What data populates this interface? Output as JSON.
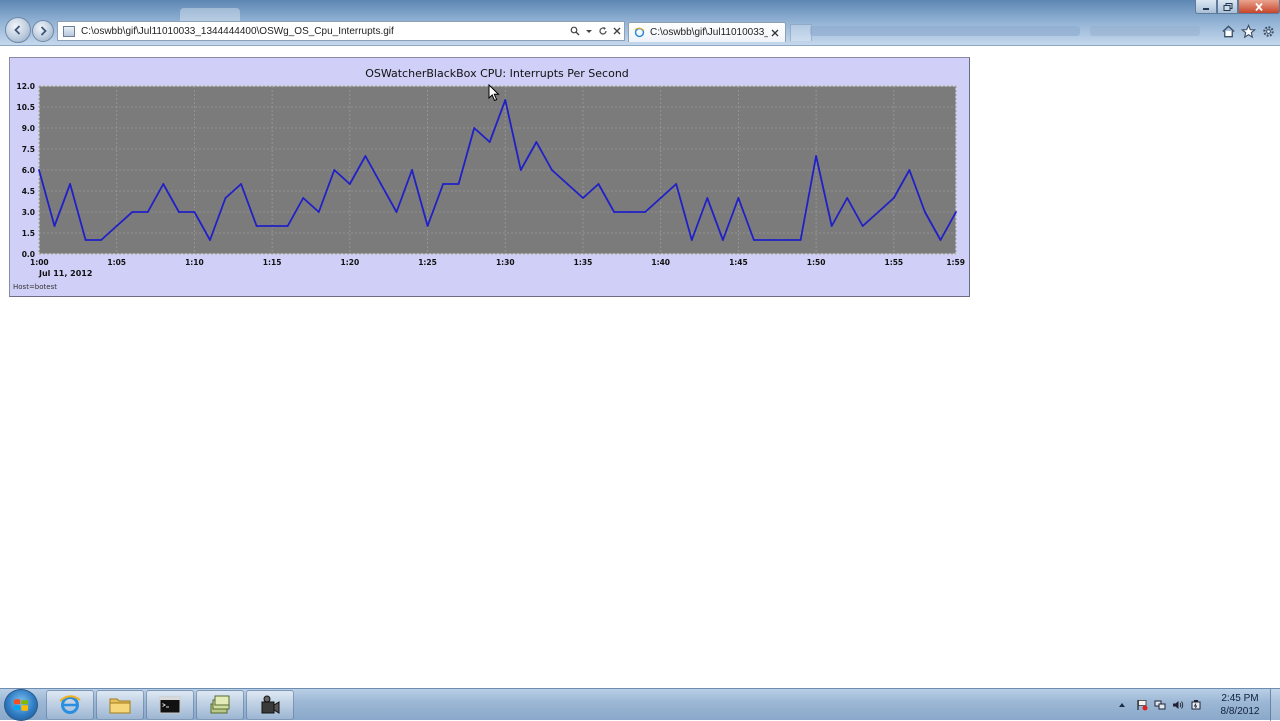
{
  "browser": {
    "address": "C:\\oswbb\\gif\\Jul11010033_1344444400\\OSWg_OS_Cpu_Interrupts.gif",
    "active_tab_title": "C:\\oswbb\\gif\\Jul11010033_...",
    "colors": {
      "chrome": "#9db8d6",
      "close": "#c7452b"
    }
  },
  "chart_data": {
    "type": "line",
    "title": "OSWatcherBlackBox CPU: Interrupts Per Second",
    "date_label": "Jul 11, 2012",
    "footnote": "Host=botest",
    "xlabel": "",
    "ylabel": "",
    "xlim": [
      0,
      59
    ],
    "ylim": [
      0,
      12
    ],
    "grid": true,
    "y_ticks": [
      "0.0",
      "1.5",
      "3.0",
      "4.5",
      "6.0",
      "7.5",
      "9.0",
      "10.5",
      "12.0"
    ],
    "x_ticks": [
      {
        "minute": 0,
        "label": "1:00"
      },
      {
        "minute": 5,
        "label": "1:05"
      },
      {
        "minute": 10,
        "label": "1:10"
      },
      {
        "minute": 15,
        "label": "1:15"
      },
      {
        "minute": 20,
        "label": "1:20"
      },
      {
        "minute": 25,
        "label": "1:25"
      },
      {
        "minute": 30,
        "label": "1:30"
      },
      {
        "minute": 35,
        "label": "1:35"
      },
      {
        "minute": 40,
        "label": "1:40"
      },
      {
        "minute": 45,
        "label": "1:45"
      },
      {
        "minute": 50,
        "label": "1:50"
      },
      {
        "minute": 55,
        "label": "1:55"
      },
      {
        "minute": 59,
        "label": "1:59"
      }
    ],
    "colors": {
      "frame": "#cfcff7",
      "plot": "#7b7b7b",
      "line": "#2020c8",
      "grid": "#9a9a9a"
    },
    "series": [
      {
        "x": [
          0,
          1,
          2,
          3,
          4,
          5,
          6,
          7,
          8,
          9,
          10,
          11,
          12,
          13,
          14,
          15,
          16,
          17,
          18,
          19,
          20,
          21,
          22,
          23,
          24,
          25,
          26,
          27,
          28,
          29,
          30,
          31,
          32,
          33,
          34,
          35,
          36,
          37,
          38,
          39,
          40,
          41,
          42,
          43,
          44,
          45,
          46,
          47,
          48,
          49,
          50,
          51,
          52,
          53,
          54,
          55,
          56,
          57,
          58,
          59
        ],
        "values": [
          6,
          2,
          5,
          1,
          1,
          2,
          3,
          3,
          5,
          3,
          3,
          1,
          4,
          5,
          2,
          2,
          2,
          4,
          3,
          6,
          5,
          7,
          5,
          3,
          6,
          2,
          5,
          5,
          9,
          8,
          11,
          6,
          8,
          6,
          5,
          4,
          5,
          3,
          3,
          3,
          4,
          5,
          1,
          4,
          1,
          4,
          1,
          1,
          1,
          1,
          7,
          2,
          4,
          2,
          3,
          4,
          6,
          3,
          1,
          3
        ]
      }
    ]
  },
  "taskbar": {
    "apps": [
      "internet-explorer-icon",
      "explorer-folder-icon",
      "command-prompt-icon",
      "stacked-windows-icon",
      "camera-recorder-icon"
    ],
    "clock_time": "2:45 PM",
    "clock_date": "8/8/2012"
  }
}
